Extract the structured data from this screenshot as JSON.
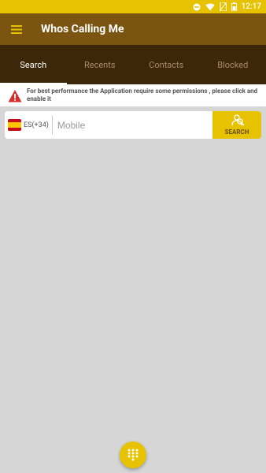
{
  "status_bar": {
    "time": "12:17",
    "icons": [
      "do-not-disturb-icon",
      "wifi-icon",
      "no-sim-icon",
      "battery-icon"
    ]
  },
  "app_bar": {
    "title": "Whos Calling Me",
    "menu_icon": "hamburger-menu-icon"
  },
  "tabs": [
    {
      "label": "Search",
      "active": true
    },
    {
      "label": "Recents",
      "active": false
    },
    {
      "label": "Contacts",
      "active": false
    },
    {
      "label": "Blocked",
      "active": false
    }
  ],
  "banner": {
    "icon": "warning-icon",
    "text": "For best performance the Application require some permissions , please click and enable it"
  },
  "search": {
    "country_code": "ES(+34)",
    "flag": "spain-flag",
    "placeholder": "Mobile",
    "button_label": "SEARCH"
  },
  "fab": {
    "icon": "dialpad-icon"
  },
  "colors": {
    "status_bar": "#e6c200",
    "app_bar": "#7a5410",
    "tabs": "#3c2808",
    "accent": "#e6c200",
    "background": "#d6d6d6"
  }
}
